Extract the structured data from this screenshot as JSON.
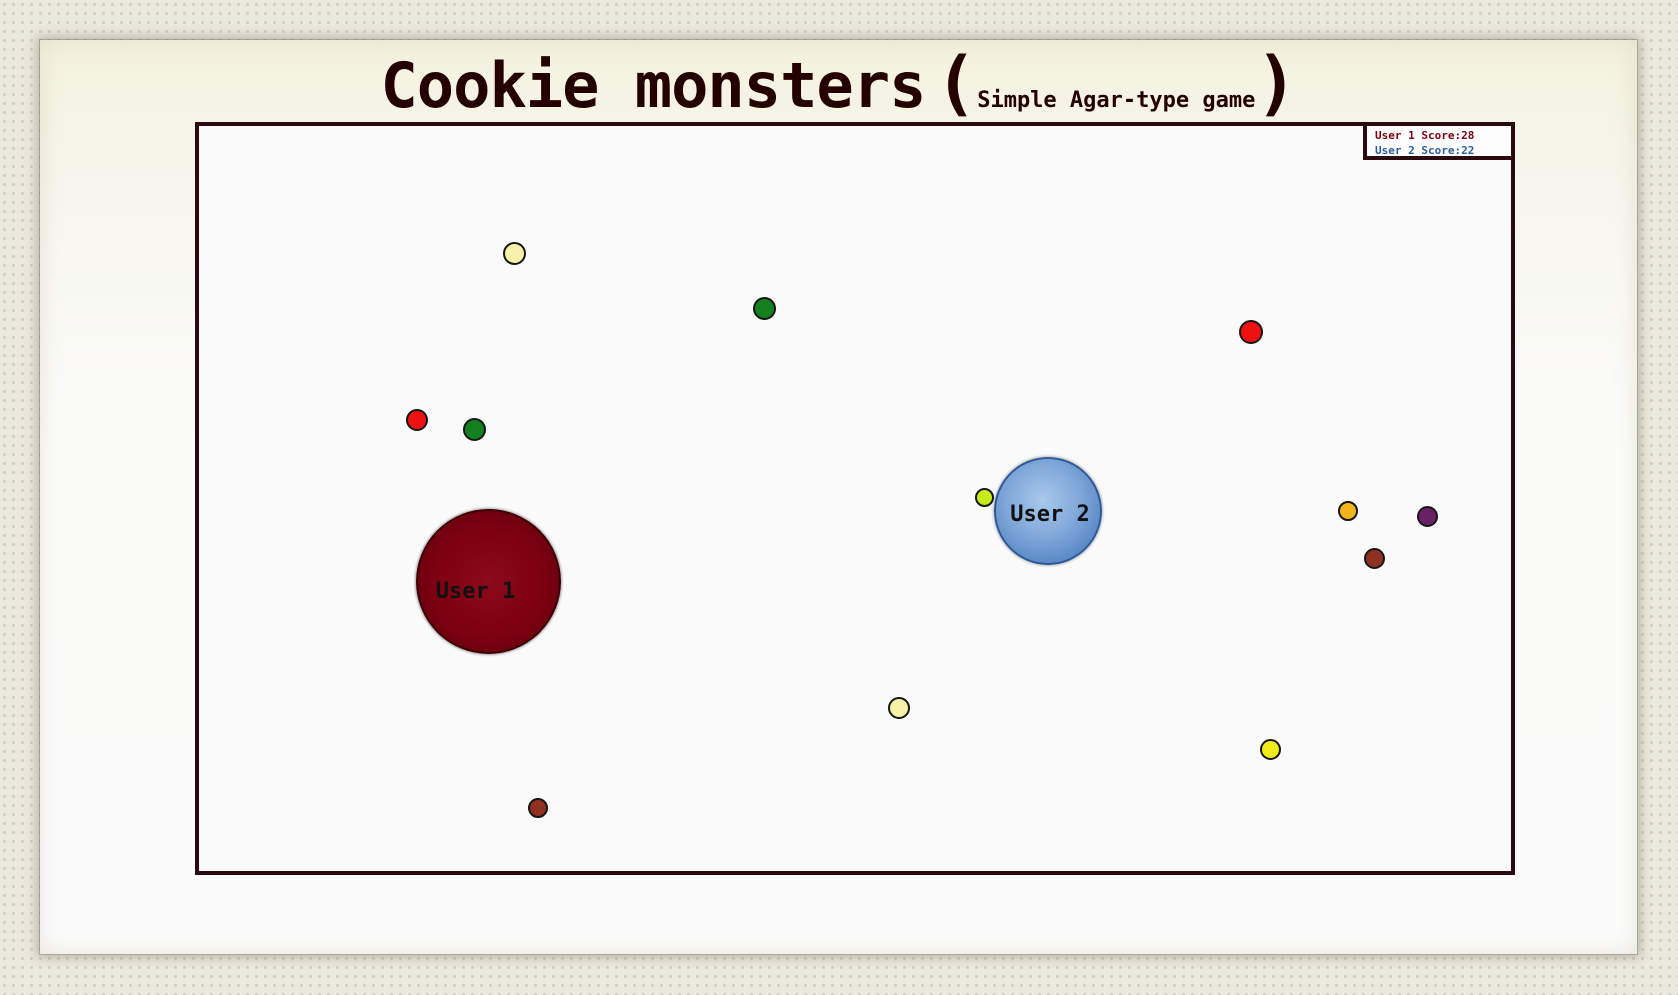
{
  "title": {
    "main": "Cookie monsters",
    "open_paren": "(",
    "subtitle": "Simple Agar-type game",
    "close_paren": ")",
    "color": "#250000"
  },
  "scoreboard": {
    "players": [
      {
        "label": "User 1 Score:",
        "score": "28",
        "color": "#7a0010"
      },
      {
        "label": "User 2 Score:",
        "score": "22",
        "color": "#2b5d9a"
      }
    ]
  },
  "players": [
    {
      "name": "User 1",
      "color": "#7b0010"
    },
    {
      "name": "User 2",
      "color": "#6f9bd2"
    }
  ],
  "cookies": [
    {
      "color": "#f7f0a8"
    },
    {
      "color": "#12801d"
    },
    {
      "color": "#ee1111"
    },
    {
      "color": "#ee1111"
    },
    {
      "color": "#12801d"
    },
    {
      "color": "#c6ea1a"
    },
    {
      "color": "#f2b51e"
    },
    {
      "color": "#6b1f66"
    },
    {
      "color": "#8f3020"
    },
    {
      "color": "#f7f0a8"
    },
    {
      "color": "#f2ea1a"
    },
    {
      "color": "#8f3020"
    }
  ]
}
